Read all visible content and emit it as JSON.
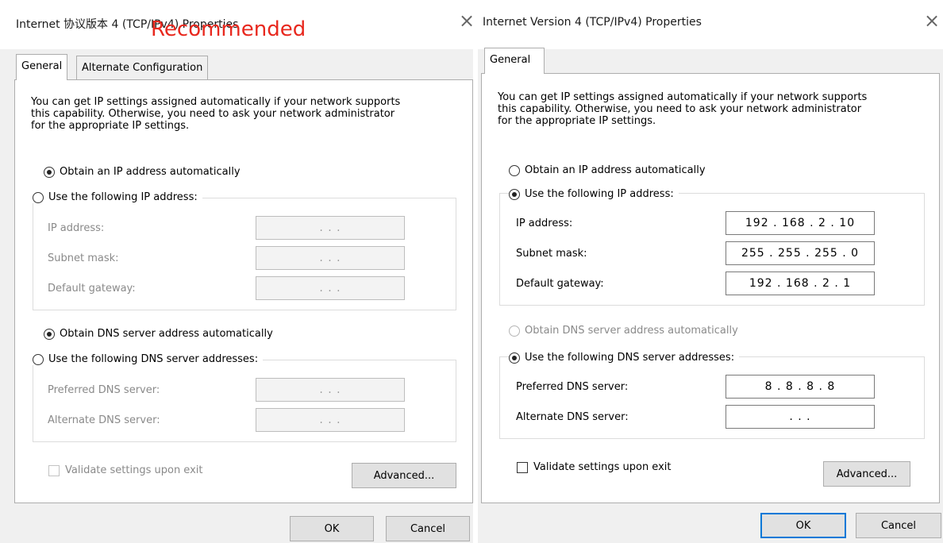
{
  "left": {
    "title": "Internet 协议版本 4 (TCP/IPv4) Properties",
    "overlay": "Recommended",
    "tabs": [
      "General",
      "Alternate Configuration"
    ],
    "description": [
      "You can get IP settings assigned automatically if your network supports",
      "this capability. Otherwise, you need to ask your network administrator",
      "for the appropriate IP settings."
    ],
    "obtain_ip": "Obtain an IP address automatically",
    "use_ip": "Use the following IP address:",
    "ip_label": "IP address:",
    "subnet_label": "Subnet mask:",
    "gateway_label": "Default gateway:",
    "ip_value": ".  .  .",
    "subnet_value": ".  .  .",
    "gateway_value": ".  .  .",
    "obtain_dns": "Obtain DNS server address automatically",
    "use_dns": "Use the following DNS server addresses:",
    "pref_label": "Preferred DNS server:",
    "alt_label": "Alternate DNS server:",
    "pref_value": ".  .  .",
    "alt_value": ".  .  .",
    "validate": "Validate settings upon exit",
    "advanced": "Advanced...",
    "ok": "OK",
    "cancel": "Cancel",
    "obtain_ip_selected": true,
    "obtain_dns_selected": true
  },
  "right": {
    "title": "Internet Version 4 (TCP/IPv4) Properties",
    "tabs": [
      "General"
    ],
    "description": [
      "You can get IP settings assigned automatically if your network supports",
      "this capability. Otherwise, you need to ask your network administrator",
      "for the appropriate IP settings."
    ],
    "obtain_ip": "Obtain an IP address automatically",
    "use_ip": "Use the following IP address:",
    "ip_label": "IP address:",
    "subnet_label": "Subnet mask:",
    "gateway_label": "Default gateway:",
    "ip_value": "192 . 168 .  2  . 10",
    "subnet_value": "255 . 255 . 255 .  0",
    "gateway_value": "192 . 168 .  2  .  1",
    "obtain_dns": "Obtain DNS server address automatically",
    "use_dns": "Use the following DNS server addresses:",
    "pref_label": "Preferred DNS server:",
    "alt_label": "Alternate DNS server:",
    "pref_value": "8  .  8  .  8  . 8",
    "alt_value": ".  .  .",
    "validate": "Validate settings upon exit",
    "advanced": "Advanced...",
    "ok": "OK",
    "cancel": "Cancel",
    "use_ip_selected": true,
    "use_dns_selected": true
  },
  "close_glyph": "×",
  "colors": {
    "accent": "#0078d7",
    "overlay_red": "#e8281e"
  }
}
